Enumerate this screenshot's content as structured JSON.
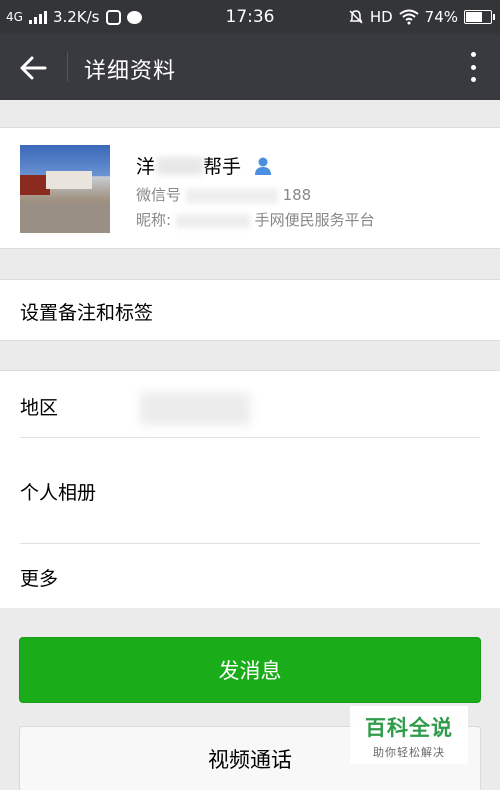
{
  "status_bar": {
    "network": "4G",
    "speed": "3.2K/s",
    "time": "17:36",
    "hd": "HD",
    "battery": "74%",
    "battery_level": 0.74
  },
  "nav": {
    "title": "详细资料"
  },
  "profile": {
    "name_visible_start": "洋",
    "name_visible_end": "帮手",
    "wechat_id_prefix": "微信号",
    "wechat_id_suffix": "188",
    "nickname_prefix": "昵称:",
    "nickname_suffix": "手网便民服务平台"
  },
  "rows": {
    "remark_label": "设置备注和标签",
    "region_label": "地区",
    "album_label": "个人相册",
    "more_label": "更多"
  },
  "buttons": {
    "send_message": "发消息",
    "video_call": "视频通话"
  },
  "watermark": {
    "main": "百科全说",
    "sub": "助你轻松解决"
  },
  "colors": {
    "primary_green": "#1aad19",
    "nav_bg": "#393a3f",
    "verified_blue": "#4a8fe0"
  }
}
